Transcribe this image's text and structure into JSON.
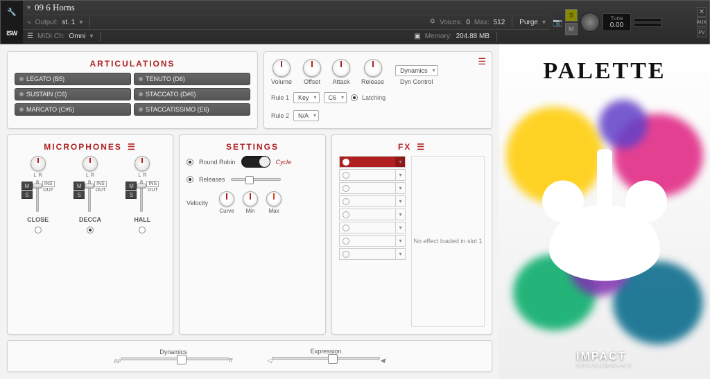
{
  "header": {
    "logo": "ISW",
    "wrench": "🔧",
    "title": "09 6 Horns",
    "output_label": "Output:",
    "output_val": "st. 1",
    "midi_label": "MIDI Ch:",
    "midi_val": "Omni",
    "voices_label": "Voices:",
    "voices_val": "0",
    "max_label": "Max:",
    "max_val": "512",
    "mem_label": "Memory:",
    "mem_val": "204.88 MB",
    "purge": "Purge",
    "tune_label": "Tune",
    "tune_val": "0.00",
    "s": "S",
    "m": "M"
  },
  "articulations": {
    "title": "ARTICULATIONS",
    "items": [
      "LEGATO (B5)",
      "TENUTO (D6)",
      "SUSTAIN (C6)",
      "STACCATO (D#6)",
      "MARCATO (C#6)",
      "STACCATISSIMO (E6)"
    ]
  },
  "dyn": {
    "knobs": [
      "Volume",
      "Offset",
      "Attack",
      "Release"
    ],
    "dyn_control": "Dyn Control",
    "dyn_val": "Dynamics",
    "rule1": "Rule 1",
    "rule1_type": "Key",
    "rule1_val": "C6",
    "latching": "Latching",
    "rule2": "Rule 2",
    "rule2_val": "N/A"
  },
  "mics": {
    "title": "MICROPHONES",
    "strips": [
      {
        "name": "CLOSE",
        "sel": false,
        "l": "L",
        "r": "R",
        "m": "M",
        "s": "S",
        "ins": "INS",
        "out": "OUT"
      },
      {
        "name": "DECCA",
        "sel": true,
        "l": "L",
        "r": "R",
        "m": "M",
        "s": "S",
        "ins": "INS",
        "out": "OUT"
      },
      {
        "name": "HALL",
        "sel": false,
        "l": "L",
        "r": "R",
        "m": "M",
        "s": "S",
        "ins": "INS",
        "out": "OUT"
      }
    ]
  },
  "settings": {
    "title": "SETTINGS",
    "round_robin": "Round Robin",
    "cycle": "Cycle",
    "releases": "Releases",
    "velocity": "Velocity",
    "vel_knobs": [
      "Curve",
      "Min",
      "Max"
    ]
  },
  "fx": {
    "title": "FX",
    "detail": "No effect loaded in slot 1",
    "slot_count": 8
  },
  "bottom": {
    "dyn_label": "Dynamics",
    "dyn_l": "pp",
    "dyn_r": "ff",
    "exp_label": "Expression",
    "exp_l": "◁",
    "exp_r": "◀"
  },
  "brand": {
    "title": "PALETTE",
    "company": "IMPACT",
    "sub": "SOUNDWORKS"
  }
}
